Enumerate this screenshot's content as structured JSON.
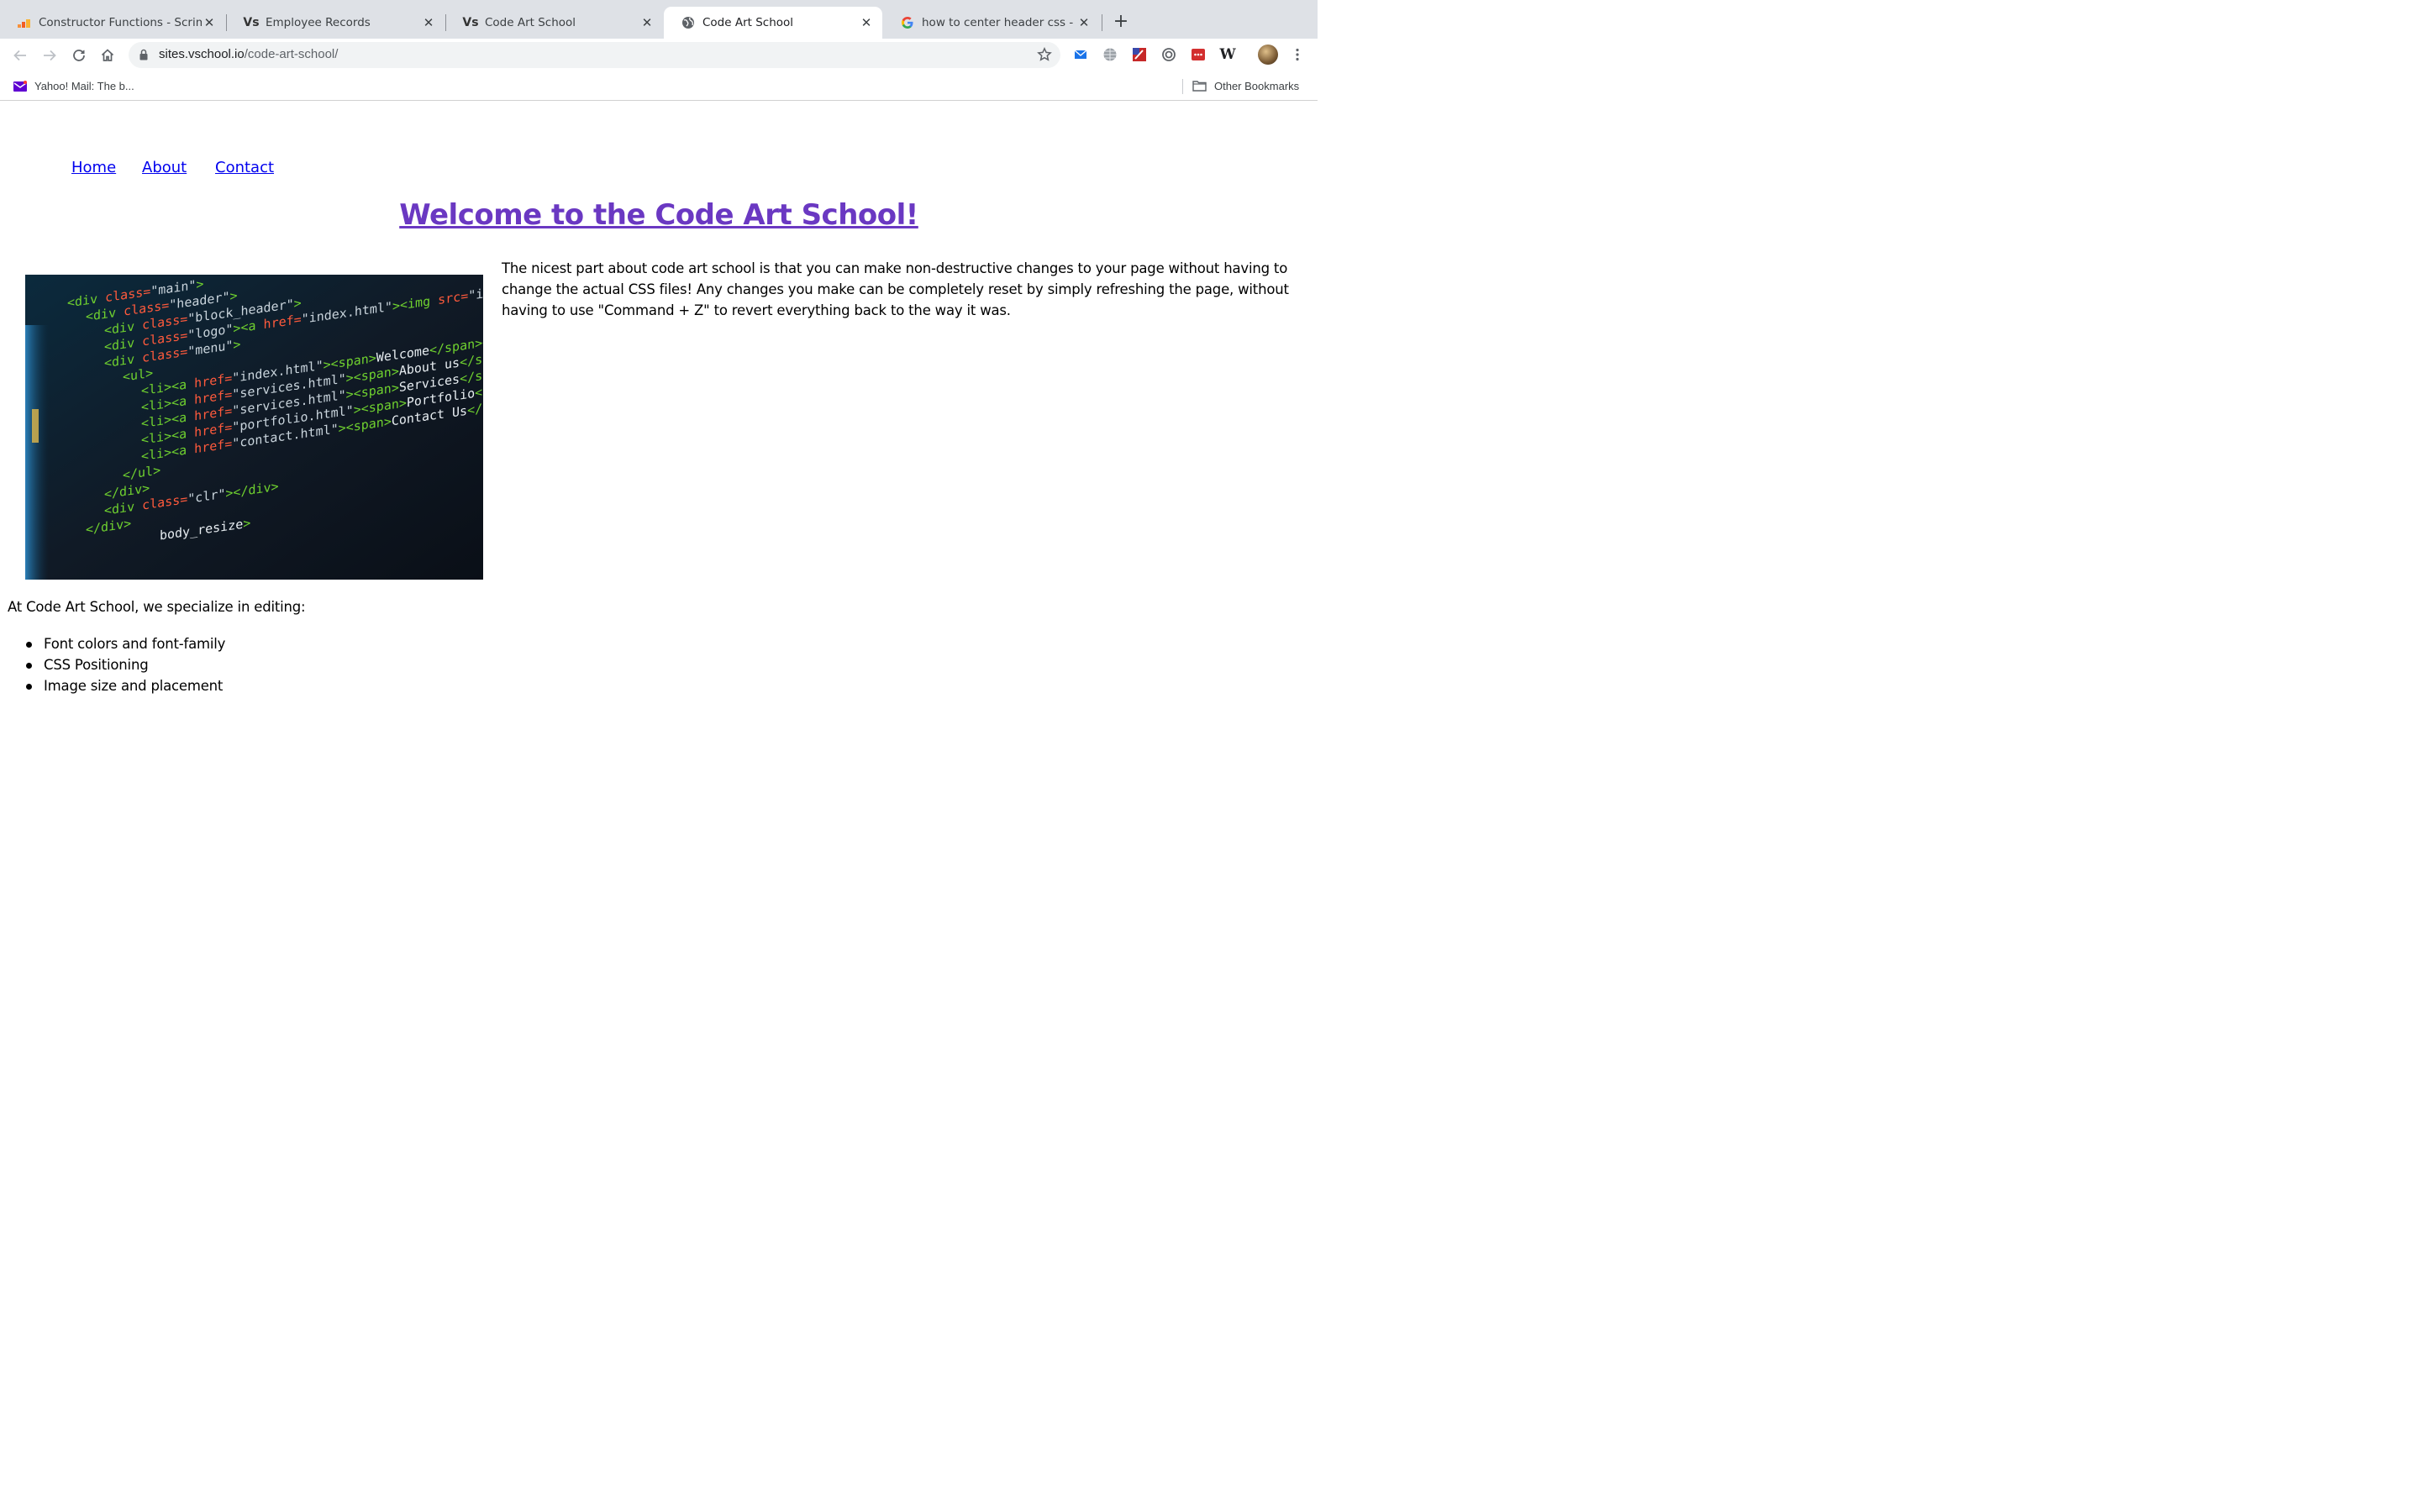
{
  "browser": {
    "tabs": [
      {
        "title": "Constructor Functions - Scrimba",
        "icon": "scrimba-icon",
        "active": false
      },
      {
        "title": "Employee Records",
        "icon": "vschool-icon",
        "active": false
      },
      {
        "title": "Code Art School",
        "icon": "vschool-icon",
        "active": false
      },
      {
        "title": "Code Art School",
        "icon": "globe-icon",
        "active": true
      },
      {
        "title": "how to center header css - Google Search",
        "icon": "google-icon",
        "active": false
      }
    ],
    "address": {
      "host": "sites.vschool.io",
      "path": "/code-art-school/"
    },
    "extensions": [
      "mail-extension-icon",
      "globe-extension-icon",
      "flag-extension-icon",
      "circle-extension-icon",
      "password-extension-icon",
      "wikipedia-icon"
    ],
    "bookmarks": [
      {
        "label": "Yahoo! Mail: The b...",
        "icon": "yahoo-mail-icon"
      }
    ],
    "other_bookmarks": "Other Bookmarks"
  },
  "page": {
    "nav": [
      "Home",
      "About",
      "Contact"
    ],
    "heading": "Welcome to the Code Art School!",
    "intro": "The nicest part about code art school is that you can make non-destructive changes to your page without having to change the actual CSS files! Any changes you make can be completely reset by simply refreshing the page, without having to use \"Command + Z\" to revert everything back to the way it was.",
    "lead": "At Code Art School, we specialize in editing:",
    "features": [
      "Font colors and font-family",
      "CSS Positioning",
      "Image size and placement"
    ],
    "image": {
      "subject": "code-screenshot",
      "code_lines": [
        "<div class=\"main\">",
        "<div class=\"header\">",
        "<div class=\"block_header\">",
        "<div class=\"logo\"><a href=\"index.html\"><img src=\"images/logo.gif\"",
        "<div class=\"menu\">",
        "<ul>",
        "<li><a href=\"index.html\"><span>Welcome</span></a></li>",
        "<li><a href=\"services.html\"><span>About us</span></a></li>",
        "<li><a href=\"services.html\"><span>Services</span></a></li>",
        "<li><a href=\"portfolio.html\"><span>Portfolio</span></a></li>",
        "<li><a href=\"contact.html\"><span>Contact Us</span></a></li>",
        "</ul>",
        "</div>",
        "<div class=\"clr\"></div>",
        "</div>",
        "body_resize\">"
      ]
    }
  },
  "colors": {
    "heading": "#6a38c2",
    "link": "#0000ee",
    "tabstrip": "#dee1e6"
  }
}
